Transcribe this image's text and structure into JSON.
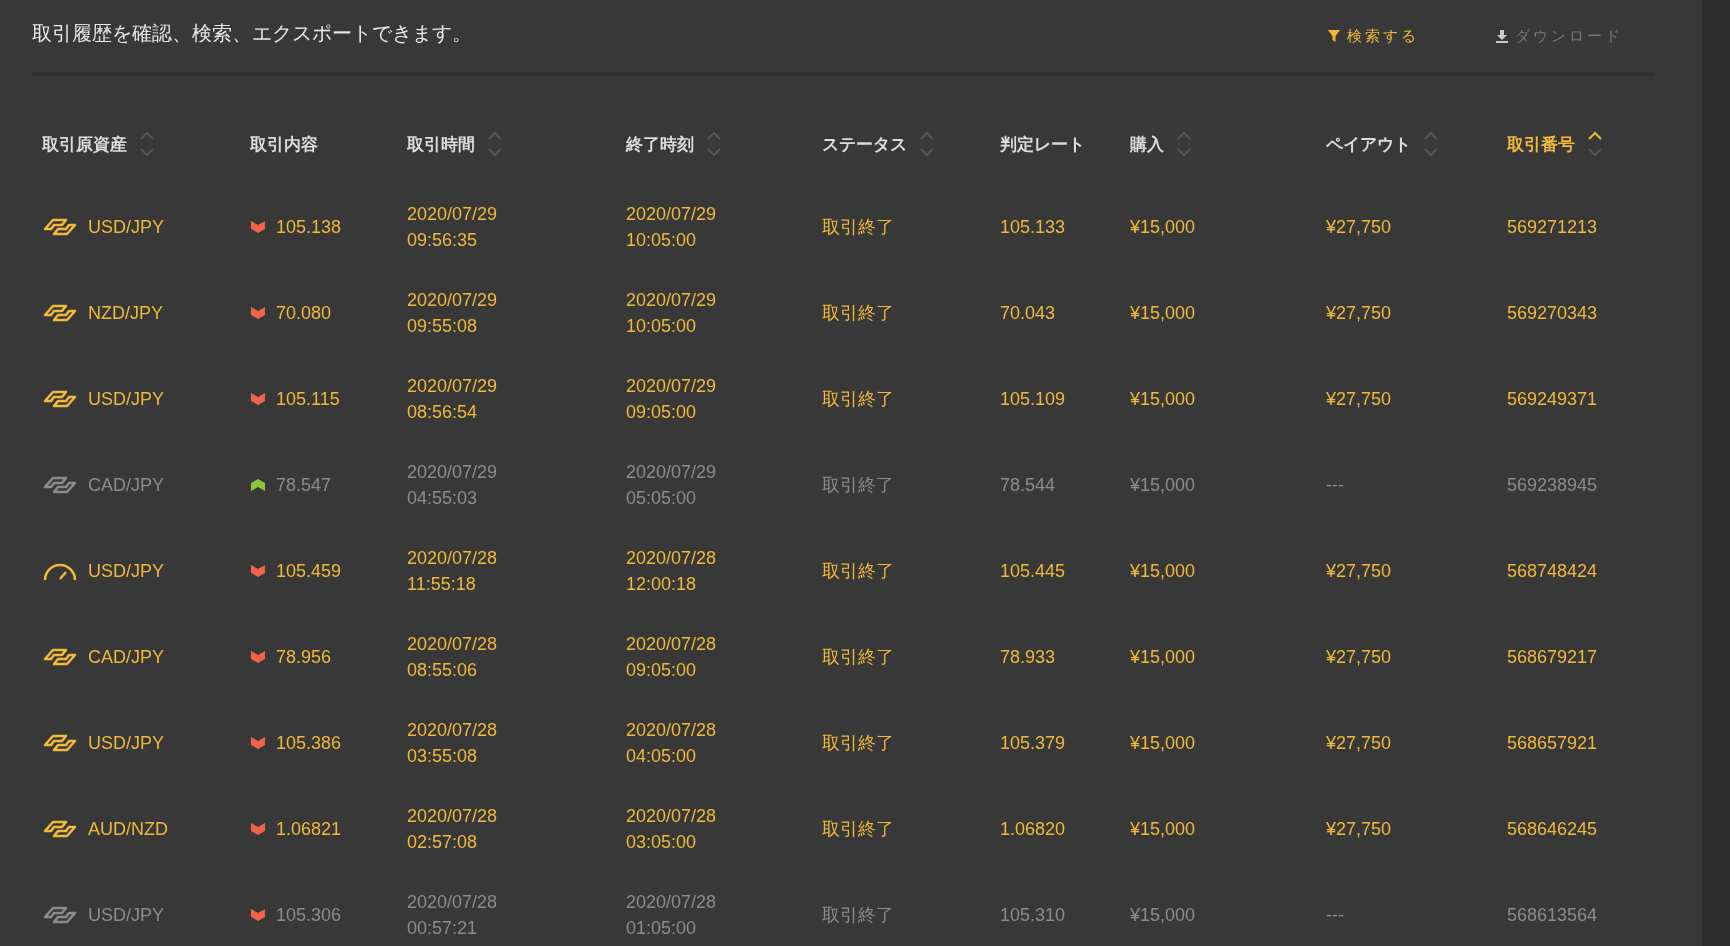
{
  "description": "取引履歴を確認、検索、エクスポートできます。",
  "actions": [
    {
      "kind": "filter",
      "label": "検索する",
      "disabled": false
    },
    {
      "kind": "download",
      "label": "ダウンロード",
      "disabled": true
    }
  ],
  "table": {
    "columns": [
      {
        "label": "取引原資産",
        "sortable": true,
        "selected": false
      },
      {
        "label": "取引内容",
        "sortable": false,
        "selected": false
      },
      {
        "label": "取引時間",
        "sortable": true,
        "selected": false
      },
      {
        "label": "終了時刻",
        "sortable": true,
        "selected": false
      },
      {
        "label": "ステータス",
        "sortable": true,
        "selected": false
      },
      {
        "label": "判定レート",
        "sortable": false,
        "selected": false
      },
      {
        "label": "購入",
        "sortable": true,
        "selected": false
      },
      {
        "label": "ペイアウト",
        "sortable": true,
        "selected": false
      },
      {
        "label": "取引番号",
        "sortable": true,
        "selected": true
      }
    ],
    "rows": [
      {
        "won": true,
        "asset": {
          "kind": "exchange",
          "name": "USD/JPY"
        },
        "rising": false,
        "entry": "105.138",
        "date": "2020/07/29",
        "time": "09:56:35",
        "end_date": "2020/07/29",
        "end_time": "10:05:00",
        "status": "取引終了",
        "rate": "105.133",
        "purchase": "¥15,000",
        "payout": "¥27,750",
        "id": "569271213"
      },
      {
        "won": true,
        "asset": {
          "kind": "exchange",
          "name": "NZD/JPY"
        },
        "rising": false,
        "entry": "70.080",
        "date": "2020/07/29",
        "time": "09:55:08",
        "end_date": "2020/07/29",
        "end_time": "10:05:00",
        "status": "取引終了",
        "rate": "70.043",
        "purchase": "¥15,000",
        "payout": "¥27,750",
        "id": "569270343"
      },
      {
        "won": true,
        "asset": {
          "kind": "exchange",
          "name": "USD/JPY"
        },
        "rising": false,
        "entry": "105.115",
        "date": "2020/07/29",
        "time": "08:56:54",
        "end_date": "2020/07/29",
        "end_time": "09:05:00",
        "status": "取引終了",
        "rate": "105.109",
        "purchase": "¥15,000",
        "payout": "¥27,750",
        "id": "569249371"
      },
      {
        "won": false,
        "asset": {
          "kind": "exchange",
          "name": "CAD/JPY"
        },
        "rising": true,
        "entry": "78.547",
        "date": "2020/07/29",
        "time": "04:55:03",
        "end_date": "2020/07/29",
        "end_time": "05:05:00",
        "status": "取引終了",
        "rate": "78.544",
        "purchase": "¥15,000",
        "payout": "---",
        "id": "569238945"
      },
      {
        "won": true,
        "asset": {
          "kind": "gauge",
          "name": "USD/JPY"
        },
        "rising": false,
        "entry": "105.459",
        "date": "2020/07/28",
        "time": "11:55:18",
        "end_date": "2020/07/28",
        "end_time": "12:00:18",
        "status": "取引終了",
        "rate": "105.445",
        "purchase": "¥15,000",
        "payout": "¥27,750",
        "id": "568748424"
      },
      {
        "won": true,
        "asset": {
          "kind": "exchange",
          "name": "CAD/JPY"
        },
        "rising": false,
        "entry": "78.956",
        "date": "2020/07/28",
        "time": "08:55:06",
        "end_date": "2020/07/28",
        "end_time": "09:05:00",
        "status": "取引終了",
        "rate": "78.933",
        "purchase": "¥15,000",
        "payout": "¥27,750",
        "id": "568679217"
      },
      {
        "won": true,
        "asset": {
          "kind": "exchange",
          "name": "USD/JPY"
        },
        "rising": false,
        "entry": "105.386",
        "date": "2020/07/28",
        "time": "03:55:08",
        "end_date": "2020/07/28",
        "end_time": "04:05:00",
        "status": "取引終了",
        "rate": "105.379",
        "purchase": "¥15,000",
        "payout": "¥27,750",
        "id": "568657921"
      },
      {
        "won": true,
        "asset": {
          "kind": "exchange",
          "name": "AUD/NZD"
        },
        "rising": false,
        "entry": "1.06821",
        "date": "2020/07/28",
        "time": "02:57:08",
        "end_date": "2020/07/28",
        "end_time": "03:05:00",
        "status": "取引終了",
        "rate": "1.06820",
        "purchase": "¥15,000",
        "payout": "¥27,750",
        "id": "568646245"
      },
      {
        "won": false,
        "asset": {
          "kind": "exchange",
          "name": "USD/JPY"
        },
        "rising": false,
        "entry": "105.306",
        "date": "2020/07/28",
        "time": "00:57:21",
        "end_date": "2020/07/28",
        "end_time": "01:05:00",
        "status": "取引終了",
        "rate": "105.310",
        "purchase": "¥15,000",
        "payout": "---",
        "id": "568613564"
      }
    ]
  }
}
